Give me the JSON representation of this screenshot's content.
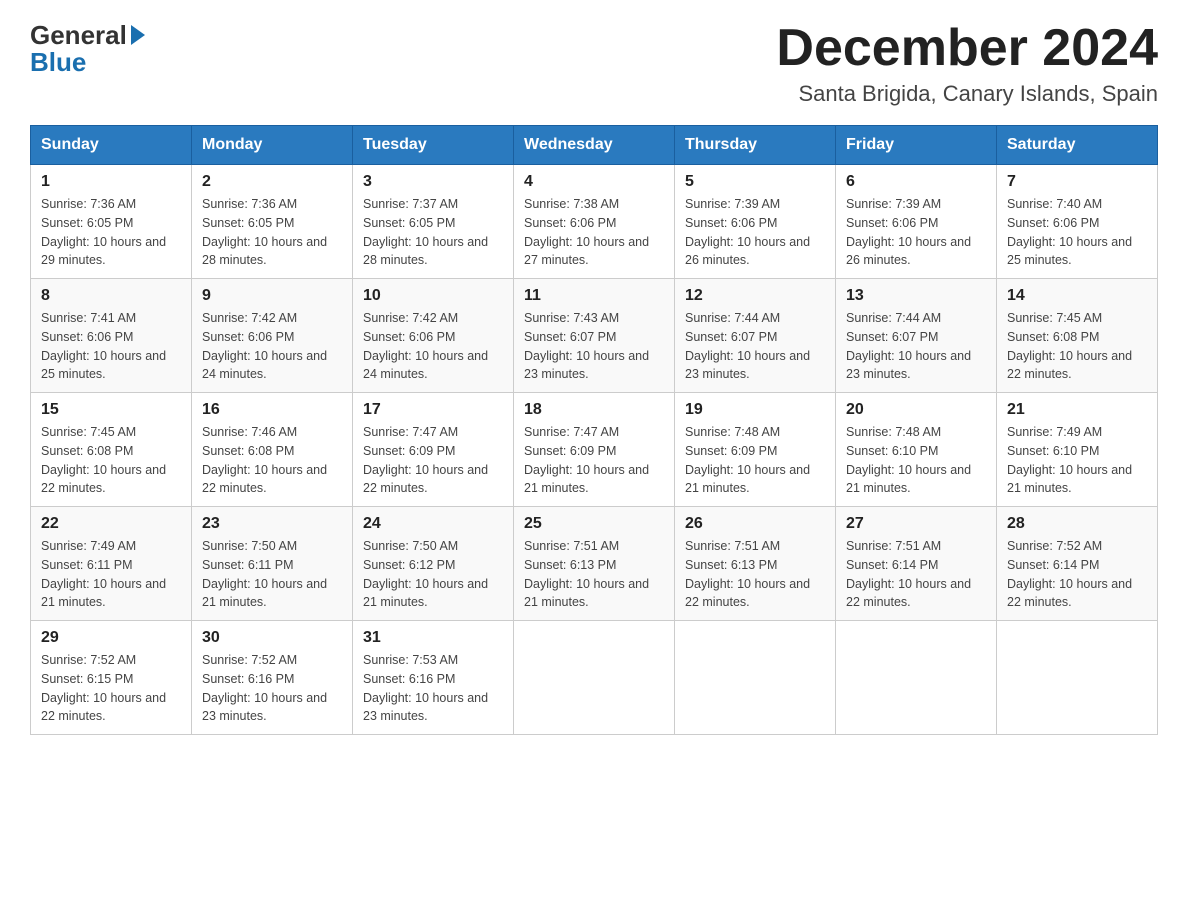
{
  "logo": {
    "general": "General",
    "blue": "Blue",
    "arrow": "▶"
  },
  "title": {
    "month": "December 2024",
    "location": "Santa Brigida, Canary Islands, Spain"
  },
  "headers": [
    "Sunday",
    "Monday",
    "Tuesday",
    "Wednesday",
    "Thursday",
    "Friday",
    "Saturday"
  ],
  "weeks": [
    [
      {
        "day": "1",
        "sunrise": "7:36 AM",
        "sunset": "6:05 PM",
        "daylight": "10 hours and 29 minutes."
      },
      {
        "day": "2",
        "sunrise": "7:36 AM",
        "sunset": "6:05 PM",
        "daylight": "10 hours and 28 minutes."
      },
      {
        "day": "3",
        "sunrise": "7:37 AM",
        "sunset": "6:05 PM",
        "daylight": "10 hours and 28 minutes."
      },
      {
        "day": "4",
        "sunrise": "7:38 AM",
        "sunset": "6:06 PM",
        "daylight": "10 hours and 27 minutes."
      },
      {
        "day": "5",
        "sunrise": "7:39 AM",
        "sunset": "6:06 PM",
        "daylight": "10 hours and 26 minutes."
      },
      {
        "day": "6",
        "sunrise": "7:39 AM",
        "sunset": "6:06 PM",
        "daylight": "10 hours and 26 minutes."
      },
      {
        "day": "7",
        "sunrise": "7:40 AM",
        "sunset": "6:06 PM",
        "daylight": "10 hours and 25 minutes."
      }
    ],
    [
      {
        "day": "8",
        "sunrise": "7:41 AM",
        "sunset": "6:06 PM",
        "daylight": "10 hours and 25 minutes."
      },
      {
        "day": "9",
        "sunrise": "7:42 AM",
        "sunset": "6:06 PM",
        "daylight": "10 hours and 24 minutes."
      },
      {
        "day": "10",
        "sunrise": "7:42 AM",
        "sunset": "6:06 PM",
        "daylight": "10 hours and 24 minutes."
      },
      {
        "day": "11",
        "sunrise": "7:43 AM",
        "sunset": "6:07 PM",
        "daylight": "10 hours and 23 minutes."
      },
      {
        "day": "12",
        "sunrise": "7:44 AM",
        "sunset": "6:07 PM",
        "daylight": "10 hours and 23 minutes."
      },
      {
        "day": "13",
        "sunrise": "7:44 AM",
        "sunset": "6:07 PM",
        "daylight": "10 hours and 23 minutes."
      },
      {
        "day": "14",
        "sunrise": "7:45 AM",
        "sunset": "6:08 PM",
        "daylight": "10 hours and 22 minutes."
      }
    ],
    [
      {
        "day": "15",
        "sunrise": "7:45 AM",
        "sunset": "6:08 PM",
        "daylight": "10 hours and 22 minutes."
      },
      {
        "day": "16",
        "sunrise": "7:46 AM",
        "sunset": "6:08 PM",
        "daylight": "10 hours and 22 minutes."
      },
      {
        "day": "17",
        "sunrise": "7:47 AM",
        "sunset": "6:09 PM",
        "daylight": "10 hours and 22 minutes."
      },
      {
        "day": "18",
        "sunrise": "7:47 AM",
        "sunset": "6:09 PM",
        "daylight": "10 hours and 21 minutes."
      },
      {
        "day": "19",
        "sunrise": "7:48 AM",
        "sunset": "6:09 PM",
        "daylight": "10 hours and 21 minutes."
      },
      {
        "day": "20",
        "sunrise": "7:48 AM",
        "sunset": "6:10 PM",
        "daylight": "10 hours and 21 minutes."
      },
      {
        "day": "21",
        "sunrise": "7:49 AM",
        "sunset": "6:10 PM",
        "daylight": "10 hours and 21 minutes."
      }
    ],
    [
      {
        "day": "22",
        "sunrise": "7:49 AM",
        "sunset": "6:11 PM",
        "daylight": "10 hours and 21 minutes."
      },
      {
        "day": "23",
        "sunrise": "7:50 AM",
        "sunset": "6:11 PM",
        "daylight": "10 hours and 21 minutes."
      },
      {
        "day": "24",
        "sunrise": "7:50 AM",
        "sunset": "6:12 PM",
        "daylight": "10 hours and 21 minutes."
      },
      {
        "day": "25",
        "sunrise": "7:51 AM",
        "sunset": "6:13 PM",
        "daylight": "10 hours and 21 minutes."
      },
      {
        "day": "26",
        "sunrise": "7:51 AM",
        "sunset": "6:13 PM",
        "daylight": "10 hours and 22 minutes."
      },
      {
        "day": "27",
        "sunrise": "7:51 AM",
        "sunset": "6:14 PM",
        "daylight": "10 hours and 22 minutes."
      },
      {
        "day": "28",
        "sunrise": "7:52 AM",
        "sunset": "6:14 PM",
        "daylight": "10 hours and 22 minutes."
      }
    ],
    [
      {
        "day": "29",
        "sunrise": "7:52 AM",
        "sunset": "6:15 PM",
        "daylight": "10 hours and 22 minutes."
      },
      {
        "day": "30",
        "sunrise": "7:52 AM",
        "sunset": "6:16 PM",
        "daylight": "10 hours and 23 minutes."
      },
      {
        "day": "31",
        "sunrise": "7:53 AM",
        "sunset": "6:16 PM",
        "daylight": "10 hours and 23 minutes."
      },
      null,
      null,
      null,
      null
    ]
  ]
}
